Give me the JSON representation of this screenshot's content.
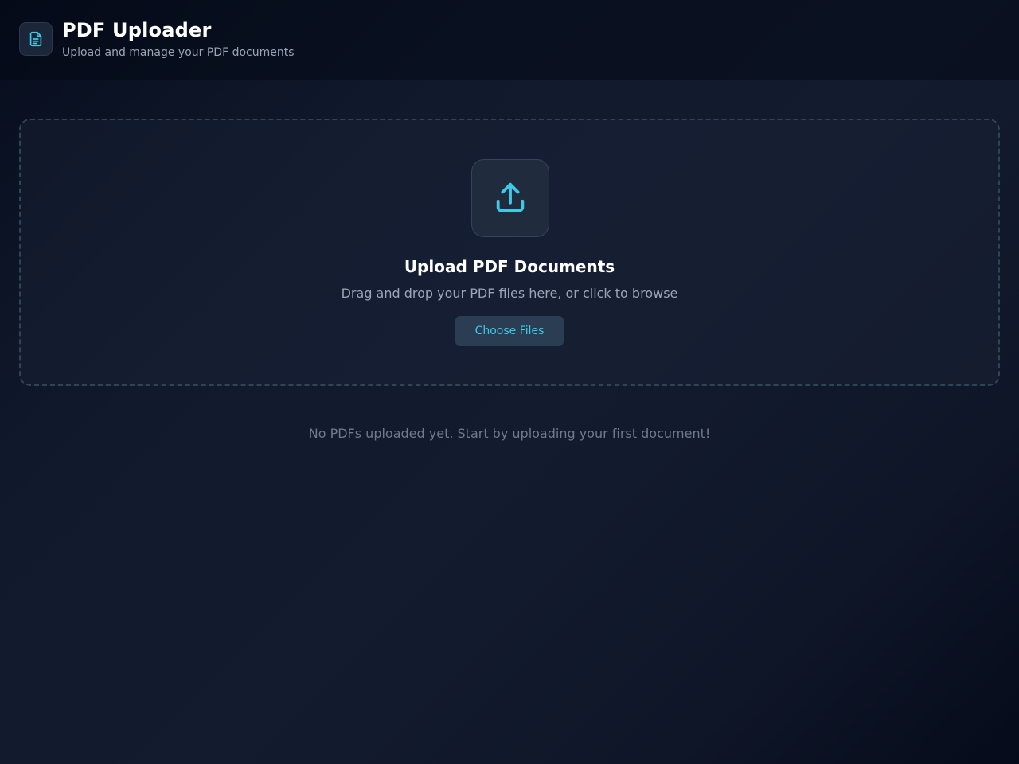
{
  "header": {
    "title": "PDF Uploader",
    "subtitle": "Upload and manage your PDF documents",
    "logo_icon": "document-icon"
  },
  "dropzone": {
    "icon": "upload-icon",
    "title": "Upload PDF Documents",
    "hint": "Drag and drop your PDF files here, or click to browse",
    "button_label": "Choose Files"
  },
  "file_list": {
    "empty_message": "No PDFs uploaded yet. Start by uploading your first document!"
  },
  "colors": {
    "accent": "#3ec9e6",
    "background": "#111a2d",
    "text_primary": "#ffffff",
    "text_secondary": "#9aa6b8"
  }
}
